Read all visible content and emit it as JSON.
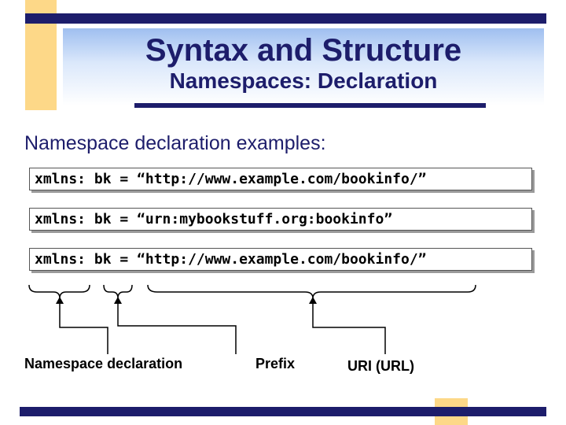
{
  "slide": {
    "title": "Syntax and Structure",
    "subtitle": "Namespaces: Declaration",
    "intro": "Namespace declaration examples:",
    "examples": [
      "xmlns: bk = “http://www.example.com/bookinfo/”",
      "xmlns: bk = “urn:mybookstuff.org:bookinfo”",
      "xmlns: bk = “http://www.example.com/bookinfo/”"
    ],
    "labels": {
      "namespace_declaration": "Namespace declaration",
      "prefix": "Prefix",
      "uri": "URI (URL)"
    }
  },
  "colors": {
    "navy": "#1d1d6b",
    "gold": "#fdd888"
  }
}
